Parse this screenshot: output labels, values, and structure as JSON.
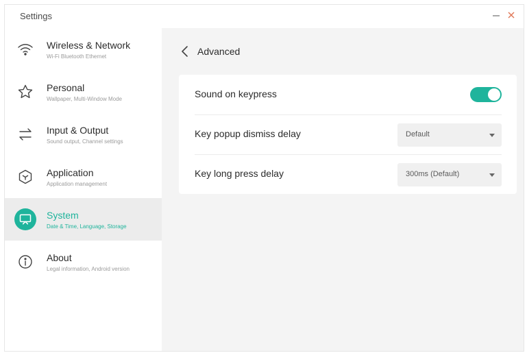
{
  "window": {
    "title": "Settings",
    "minimize_icon": "minimize-icon",
    "close_icon": "close-icon",
    "close_color": "#e07a5a"
  },
  "sidebar": {
    "accent_color": "#1fb49c",
    "items": [
      {
        "title": "Wireless & Network",
        "subtitle": "Wi-Fi Bluetooth Ethernet",
        "icon": "wifi-icon",
        "active": false
      },
      {
        "title": "Personal",
        "subtitle": "Wallpaper, Multi-Window Mode",
        "icon": "star-icon",
        "active": false
      },
      {
        "title": "Input & Output",
        "subtitle": "Sound output, Channel settings",
        "icon": "swap-arrows-icon",
        "active": false
      },
      {
        "title": "Application",
        "subtitle": "Application management",
        "icon": "hexagon-app-icon",
        "active": false
      },
      {
        "title": "System",
        "subtitle": "Date & Time, Language, Storage",
        "icon": "monitor-icon",
        "active": true
      },
      {
        "title": "About",
        "subtitle": "Legal information, Android version",
        "icon": "info-icon",
        "active": false
      }
    ]
  },
  "main": {
    "back_icon": "chevron-left-icon",
    "title": "Advanced",
    "settings": [
      {
        "label": "Sound on keypress",
        "type": "toggle",
        "value": "on"
      },
      {
        "label": "Key popup dismiss delay",
        "type": "select",
        "value": "Default"
      },
      {
        "label": "Key long press delay",
        "type": "select",
        "value": "300ms (Default)"
      }
    ]
  }
}
